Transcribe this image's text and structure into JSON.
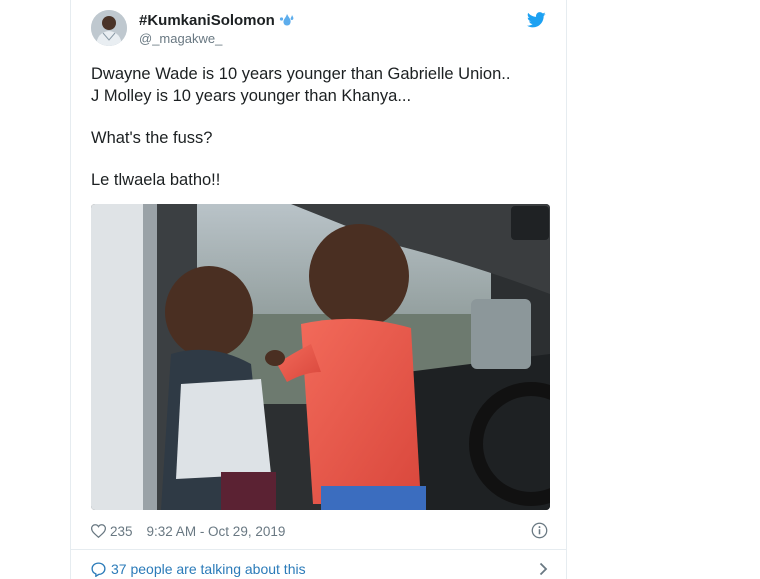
{
  "user": {
    "display_name": "#KumkaniSolomon",
    "handle": "@_magakwe_"
  },
  "tweet": {
    "lines": [
      "Dwayne Wade is 10 years younger than Gabrielle Union..",
      "J Molley is  10 years younger than Khanya...",
      "What's the fuss?",
      "Le tlwaela batho!!"
    ]
  },
  "meta": {
    "likes": "235",
    "timestamp": "9:32 AM - Oct 29, 2019"
  },
  "footer": {
    "talking_text": "37 people are talking about this"
  },
  "colors": {
    "twitter_blue": "#1da1f2",
    "link": "#2b7bb9",
    "muted": "#697882"
  },
  "icons": [
    "twitter-bird-icon",
    "splash-emoji-icon",
    "heart-icon",
    "info-icon",
    "speech-bubble-icon",
    "chevron-right-icon"
  ]
}
